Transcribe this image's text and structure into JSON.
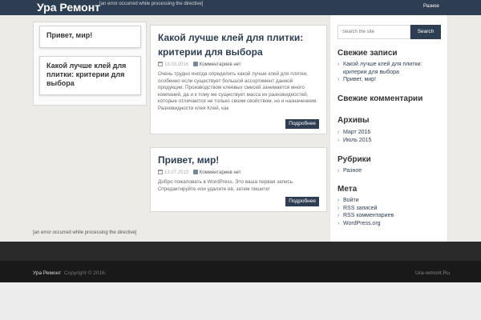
{
  "header": {
    "site_title": "Ура Ремонт",
    "directive_error": "[an error occurred while processing the directive]",
    "menu_item": "Разное"
  },
  "left_cards": [
    {
      "title": "Привет, мир!"
    },
    {
      "title": "Какой лучше клей для плитки: критерии для выбора"
    }
  ],
  "posts": [
    {
      "title": "Какой лучше клей для плитки: критерии для выбора",
      "date": "18.03.2016",
      "comments": "Комментариев нет",
      "excerpt": "Очень трудно иногда определить какой лучше клей для плитки, особенно если существует большой ассортимент данной продукции. Производством клеевых смесей занимается много компаний, да и к тому же существует масса их разновидностей, которые отличаются не только своим свойством, но и назначением. Разновидности клея Клей, как",
      "more": "Подробнее"
    },
    {
      "title": "Привет, мир!",
      "date": "13.07.2015",
      "comments": "Комментариев нет",
      "excerpt": "Добро пожаловать в WordPress. Это ваша первая запись. Отредактируйте или удалите её, затем пишите!",
      "more": "Подробнее"
    }
  ],
  "sidebar": {
    "search_placeholder": "Search the site",
    "search_button": "Search",
    "recent_posts_title": "Свежие записи",
    "recent_posts": [
      "Какой лучше клей для плитки: критерии для выбора",
      "Привет, мир!"
    ],
    "recent_comments_title": "Свежие комментарии",
    "archives_title": "Архивы",
    "archives": [
      "Март 2016",
      "Июль 2015"
    ],
    "categories_title": "Рубрики",
    "categories": [
      "Разное"
    ],
    "meta_title": "Мета",
    "meta": [
      "Войти",
      "RSS записей",
      "RSS комментариев",
      "WordPress.org"
    ]
  },
  "footer": {
    "site_name": "Ура Ремонт",
    "copyright": "Copyright © 2016.",
    "domain": "Ura-remont.Ru"
  },
  "colors": {
    "brand_dark": "#2e3e52",
    "background": "#ecebe7"
  },
  "icons": [
    "calendar-icon",
    "comment-icon",
    "chevron-right-icon"
  ]
}
